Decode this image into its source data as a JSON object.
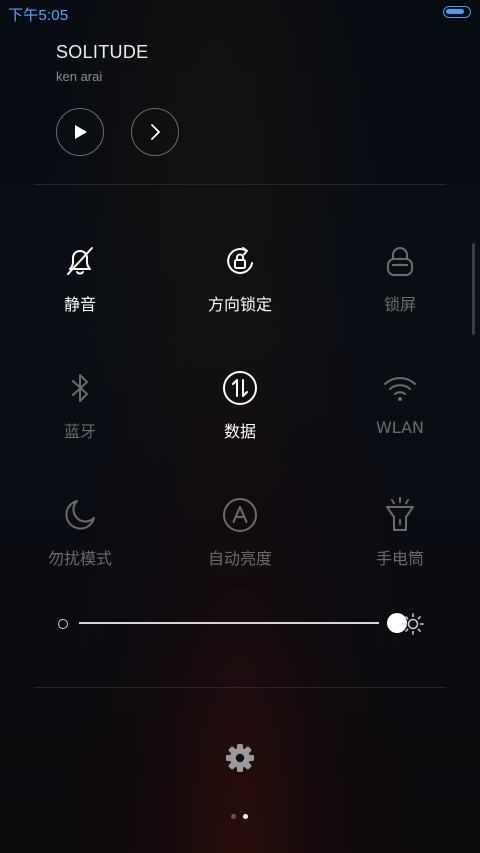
{
  "status_bar": {
    "time": "下午5:05",
    "battery_level": 0.85,
    "colors": {
      "time": "#5aa8ff",
      "battery": "#4a9cf6"
    }
  },
  "music": {
    "title": "SOLITUDE",
    "artist": "ken arai",
    "controls": [
      {
        "icon": "play-icon"
      },
      {
        "icon": "chevron-right-icon"
      }
    ]
  },
  "toggles": [
    {
      "id": "mute",
      "label": "静音",
      "icon": "bell-off-icon",
      "active": true
    },
    {
      "id": "rotation-lock",
      "label": "方向锁定",
      "icon": "rotation-lock-icon",
      "active": true
    },
    {
      "id": "lock-screen",
      "label": "锁屏",
      "icon": "lock-icon",
      "active": false
    },
    {
      "id": "bluetooth",
      "label": "蓝牙",
      "icon": "bluetooth-icon",
      "active": false
    },
    {
      "id": "data",
      "label": "数据",
      "icon": "mobile-data-icon",
      "active": true
    },
    {
      "id": "wlan",
      "label": "WLAN",
      "icon": "wifi-icon",
      "active": false
    },
    {
      "id": "do-not-disturb",
      "label": "勿扰模式",
      "icon": "moon-icon",
      "active": false
    },
    {
      "id": "auto-brightness",
      "label": "自动亮度",
      "icon": "auto-brightness-icon",
      "active": false
    },
    {
      "id": "flashlight",
      "label": "手电筒",
      "icon": "flashlight-icon",
      "active": false
    }
  ],
  "brightness": {
    "value": 1.0,
    "min_icon": "brightness-low-icon",
    "max_icon": "brightness-high-icon"
  },
  "footer": {
    "settings_icon": "gear-icon",
    "pages": 2,
    "current_page": 2
  },
  "colors": {
    "active": "#ffffff",
    "inactive": "#6b6b6b",
    "divider": "#252830"
  }
}
